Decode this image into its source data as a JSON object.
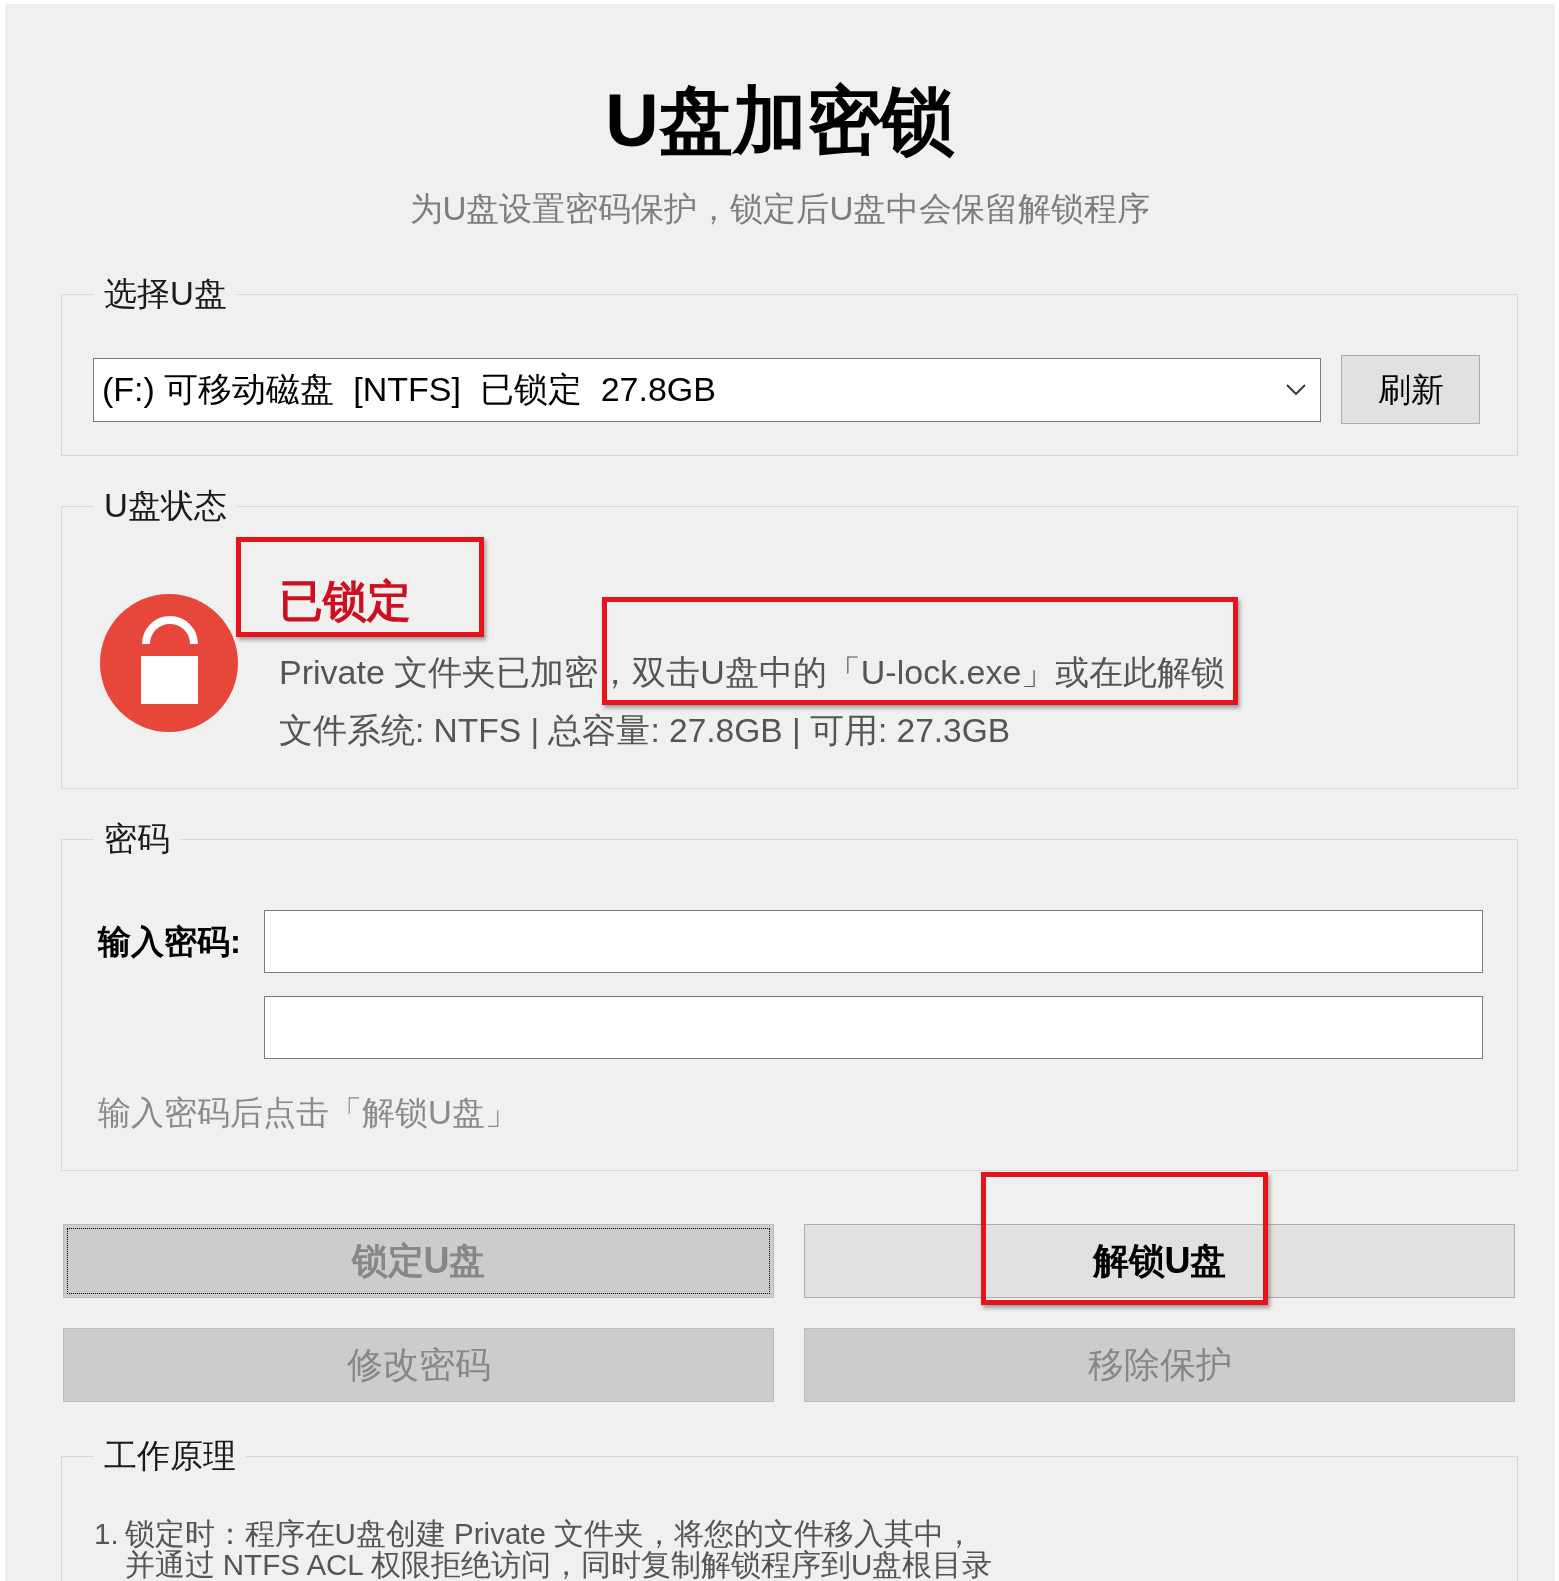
{
  "title": "U盘加密锁",
  "subtitle": "为U盘设置密码保护，锁定后U盘中会保留解锁程序",
  "drive_section": {
    "title": "选择U盘",
    "drive_dropdown": {
      "value": "(F:) 可移动磁盘  [NTFS]  已锁定  27.8GB"
    },
    "refresh_button": {
      "label": "刷新"
    }
  },
  "status_section": {
    "title": "U盘状态",
    "state": {
      "text": "已锁定",
      "locked": true,
      "highlighted": true
    },
    "description": {
      "text": "Private 文件夹已加密，双击U盘中的「U-lock.exe」或在此解锁",
      "highlighted": true
    },
    "details": "文件系统: NTFS | 总容量: 27.8GB | 可用: 27.3GB"
  },
  "password_section": {
    "title": "密码",
    "fields": [
      {
        "kind": "password",
        "label": "输入密码:"
      },
      {
        "kind": "password"
      }
    ],
    "hint": "输入密码后点击「解锁U盘」"
  },
  "buttons": [
    {
      "label": "锁定U盘",
      "kind": "primary",
      "disabled": true,
      "focused": true,
      "highlighted": false
    },
    {
      "label": "解锁U盘",
      "kind": "primary",
      "disabled": false,
      "focused": false,
      "highlighted": true
    },
    {
      "label": "修改密码",
      "kind": "secondary",
      "disabled": true,
      "focused": false,
      "highlighted": false
    },
    {
      "label": "移除保护",
      "kind": "secondary",
      "disabled": true,
      "focused": false,
      "highlighted": false
    }
  ],
  "how_it_works": {
    "title": "工作原理",
    "steps": [
      {
        "number": "1.",
        "lines": [
          "锁定时：程序在U盘创建 Private 文件夹，将您的文件移入其中，",
          "并通过 NTFS ACL 权限拒绝访问，同时复制解锁程序到U盘根目录"
        ]
      }
    ]
  }
}
